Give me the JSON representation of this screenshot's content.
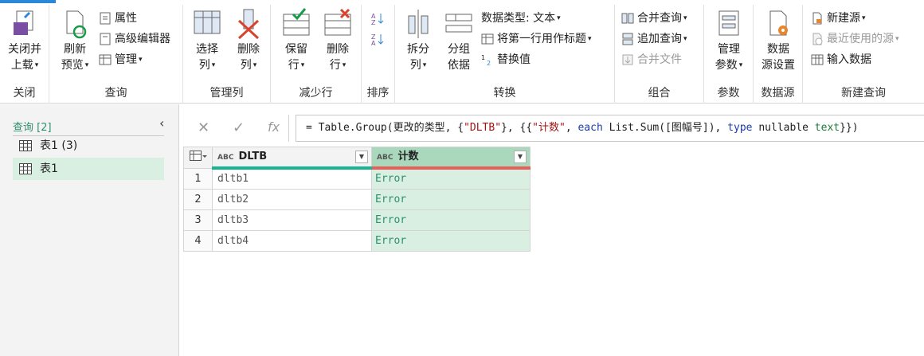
{
  "ribbon": {
    "groups": {
      "close": {
        "label": "关闭",
        "close_load": "关闭并\n上载"
      },
      "query": {
        "label": "查询",
        "refresh": "刷新\n预览",
        "properties": "属性",
        "advanced_editor": "高级编辑器",
        "manage": "管理"
      },
      "manage_cols": {
        "label": "管理列",
        "choose_cols": "选择\n列",
        "remove_cols": "删除\n列"
      },
      "reduce_rows": {
        "label": "减少行",
        "keep_rows": "保留\n行",
        "remove_rows": "删除\n行"
      },
      "sort": {
        "label": "排序"
      },
      "transform": {
        "label": "转换",
        "split_col": "拆分\n列",
        "group_by": "分组\n依据",
        "data_type": "数据类型: 文本",
        "use_first_row": "将第一行用作标题",
        "replace_values": "替换值"
      },
      "combine": {
        "label": "组合",
        "merge_queries": "合并查询",
        "append_queries": "追加查询",
        "combine_files": "合并文件"
      },
      "params": {
        "label": "参数",
        "manage_params": "管理\n参数"
      },
      "datasource": {
        "label": "数据源",
        "settings": "数据\n源设置"
      },
      "new_query": {
        "label": "新建查询",
        "new_source": "新建源",
        "recent_sources": "最近使用的源",
        "enter_data": "输入数据"
      }
    }
  },
  "queries": {
    "header": "查询 [2]",
    "items": [
      {
        "label": "表1 (3)"
      },
      {
        "label": "表1"
      }
    ]
  },
  "formula": {
    "text_parts": [
      "= Table.Group(更改的类型, {",
      "\"DLTB\"",
      "}, {{",
      "\"计数\"",
      ", ",
      "each",
      " List.Sum([图幅号]), ",
      "type",
      " nullable ",
      "text",
      "}})"
    ],
    "fx": "fx"
  },
  "table": {
    "columns": [
      {
        "type_icon": "ABC",
        "name": "DLTB"
      },
      {
        "type_icon": "ABC",
        "name": "计数"
      }
    ],
    "rows": [
      {
        "num": "1",
        "dltb": "dltb1",
        "count": "Error"
      },
      {
        "num": "2",
        "dltb": "dltb2",
        "count": "Error"
      },
      {
        "num": "3",
        "dltb": "dltb3",
        "count": "Error"
      },
      {
        "num": "4",
        "dltb": "dltb4",
        "count": "Error"
      }
    ]
  },
  "colors": {
    "accent": "#2f8f6f",
    "selected_col": "#a9d8bd",
    "error_bar": "#e8605a",
    "valid_bar": "#1ab394"
  }
}
